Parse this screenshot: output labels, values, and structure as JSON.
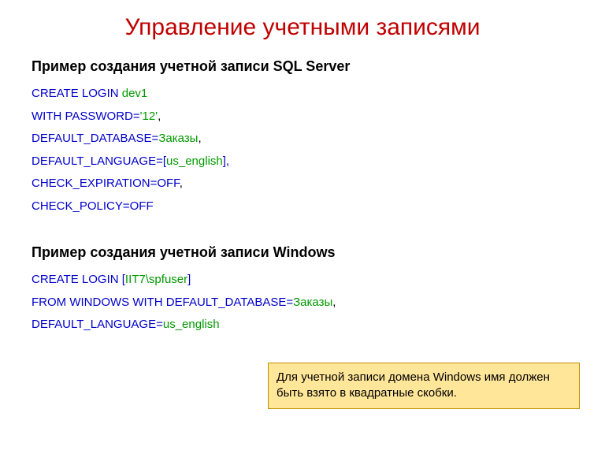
{
  "title": "Управление учетными записями",
  "section1": {
    "heading": "Пример создания учетной записи SQL Server",
    "l1": {
      "kw": "CREATE LOGIN ",
      "val": "dev1"
    },
    "l2": {
      "kw": "WITH PASSWORD=",
      "val": "'12'",
      "punct": ","
    },
    "l3": {
      "kw": "DEFAULT_DATABASE=",
      "val": "Заказы",
      "punct": ","
    },
    "l4": {
      "kw1": "DEFAULT_LANGUAGE=[",
      "val": "us_english",
      "kw2": "],"
    },
    "l5": {
      "kw": "CHECK_EXPIRATION=OFF",
      "punct": ","
    },
    "l6": {
      "kw": "CHECK_POLICY=OFF"
    }
  },
  "section2": {
    "heading": "Пример создания учетной записи Windows",
    "l1": {
      "kw1": "CREATE LOGIN [",
      "val": "IIT7\\spfuser",
      "kw2": "]"
    },
    "l2": {
      "kw": "FROM WINDOWS WITH DEFAULT_DATABASE=",
      "val": "Заказы",
      "punct": ","
    },
    "l3": {
      "kw": "DEFAULT_LANGUAGE=",
      "val": "us_english"
    }
  },
  "note": "Для учетной записи домена Windows имя должен быть взято в квадратные скобки."
}
